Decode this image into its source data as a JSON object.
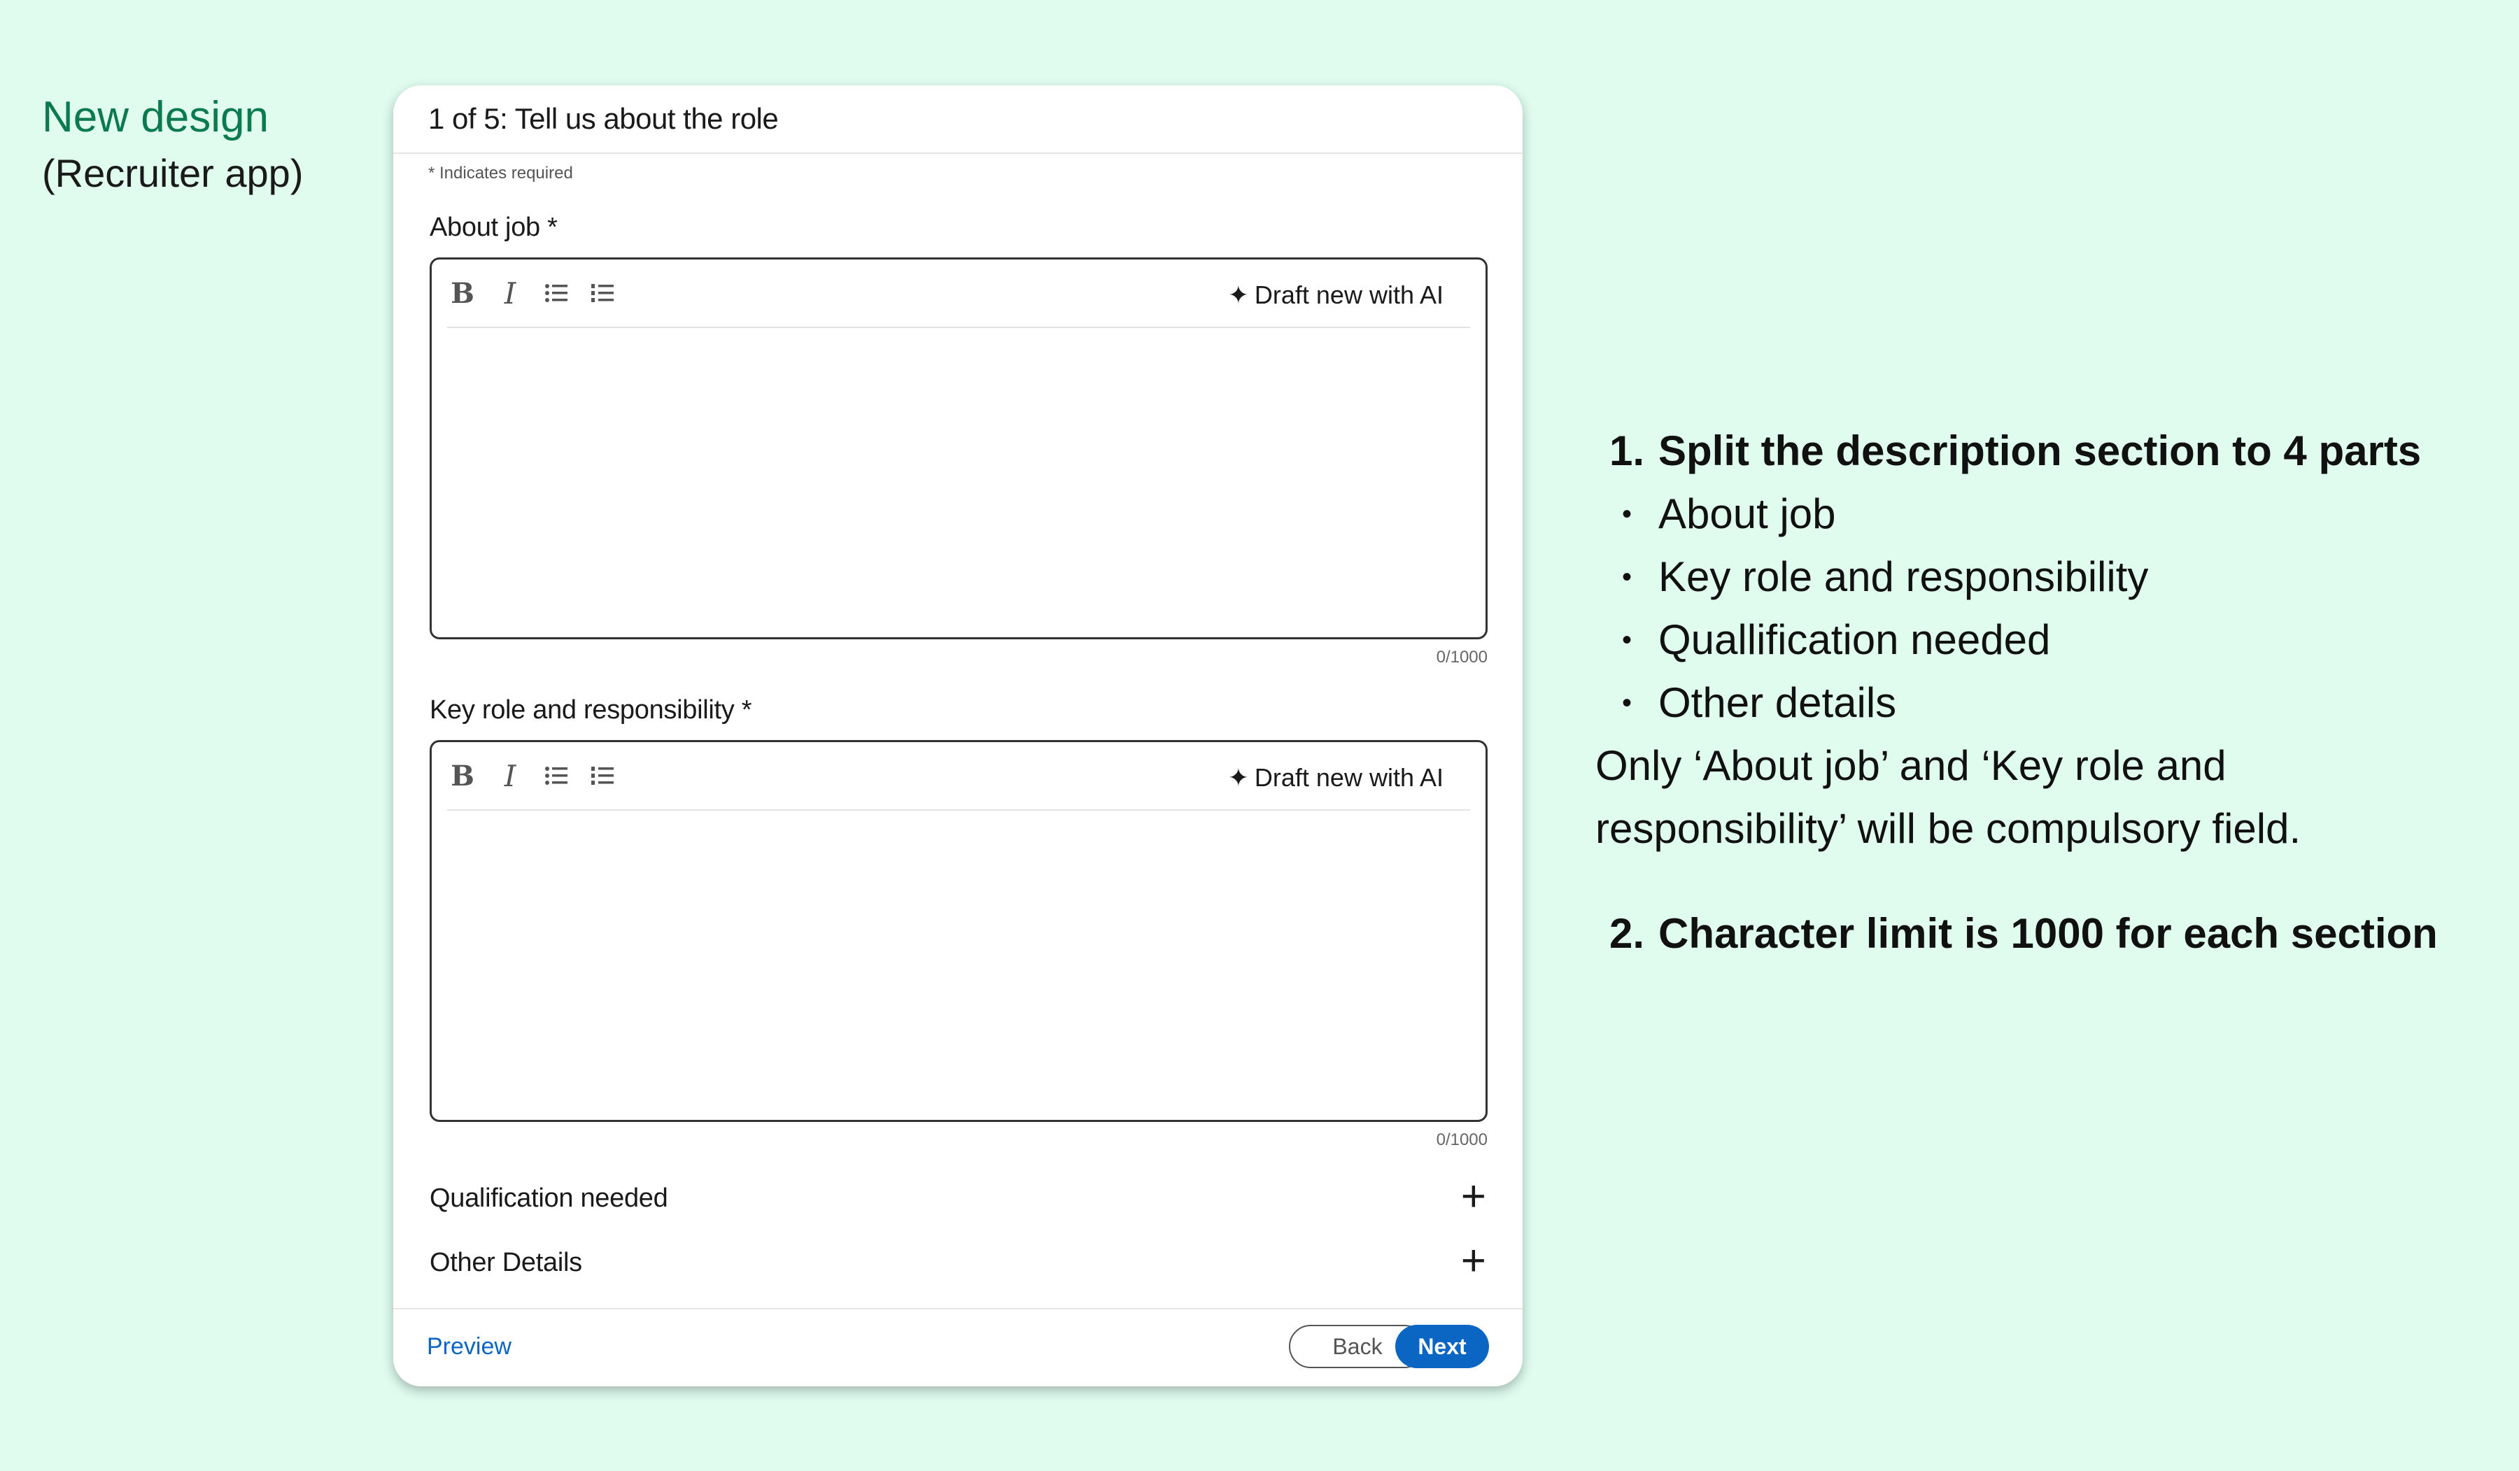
{
  "side": {
    "title": "New design",
    "subtitle": "(Recruiter app)"
  },
  "form": {
    "step_title": "1 of 5: Tell us about the role",
    "required_note": "* Indicates required",
    "fields": [
      {
        "label": "About job *",
        "ai_label": "Draft new with AI",
        "counter": "0/1000"
      },
      {
        "label": "Key role and responsibility *",
        "ai_label": "Draft new with AI",
        "counter": "0/1000"
      }
    ],
    "collapsed_sections": [
      {
        "label": "Qualification needed"
      },
      {
        "label": "Other Details"
      }
    ],
    "footer": {
      "preview_label": "Preview",
      "back_label": "Back",
      "next_label": "Next"
    }
  },
  "notes": {
    "item1_number": "1.",
    "item1_heading": "Split the description section to 4 parts",
    "item1_bullets": [
      "About job",
      "Key role and responsibility",
      "Quallification needed",
      "Other details"
    ],
    "item1_paragraph": "Only ‘About job’ and ‘Key role and responsibility’ will be compulsory field.",
    "item2_number": "2.",
    "item2_heading": "Character limit is 1000 for each section"
  },
  "icons": {
    "bold": "bold-icon",
    "italic": "italic-icon",
    "bullet_list": "bullet-list-icon",
    "numbered_list": "numbered-list-icon",
    "sparkle": "sparkle-icon",
    "plus": "plus-icon"
  },
  "colors": {
    "background": "#dffcef",
    "accent_green": "#0b7a4e",
    "primary_blue": "#0a66c2"
  }
}
